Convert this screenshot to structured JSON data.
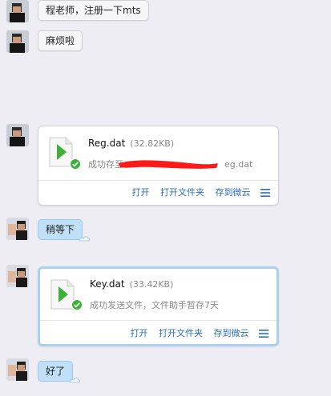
{
  "messages": [
    {
      "type": "text",
      "text": "程老师，注册一下mts"
    },
    {
      "type": "text",
      "text": "麻烦啦"
    },
    {
      "type": "file",
      "name": "Reg.dat",
      "size": "(32.82KB)",
      "status_prefix": "成功存至",
      "status_suffix": "eg.dat",
      "actions": [
        "打开",
        "打开文件夹",
        "存到微云"
      ]
    },
    {
      "type": "text",
      "text": "稍等下"
    },
    {
      "type": "file",
      "name": "Key.dat",
      "size": "(33.42KB)",
      "status": "成功发送文件，文件助手暂存7天",
      "actions": [
        "打开",
        "打开文件夹",
        "存到微云"
      ]
    },
    {
      "type": "text",
      "text": "好了"
    }
  ],
  "icons": {
    "file": "file-play-icon",
    "check": "check-circle-icon",
    "menu": "hamburger-menu-icon",
    "avatar": "user-avatar"
  },
  "colors": {
    "accent": "#2a6fb5",
    "play": "#3fb13a",
    "redaction": "#ff1a1a",
    "bubble_blue": "#bfe0f6"
  }
}
